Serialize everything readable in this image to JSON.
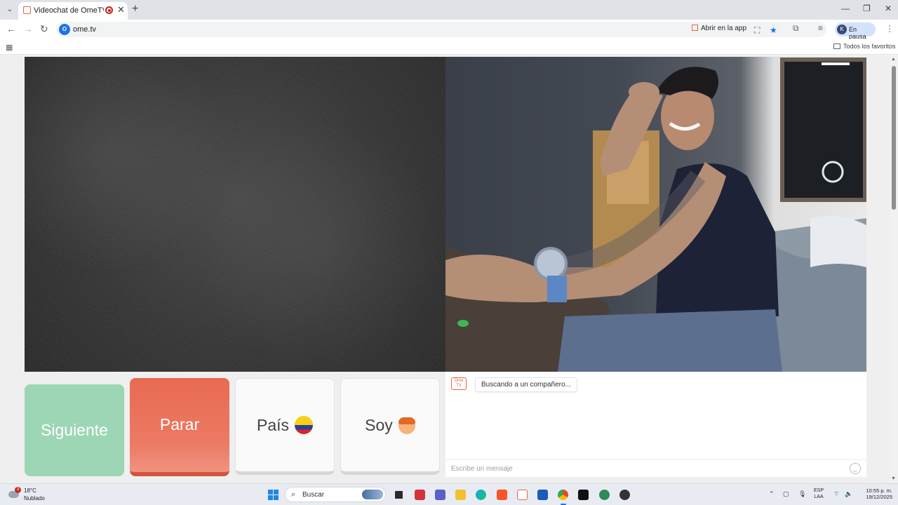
{
  "browser": {
    "tab_title": "Videochat de OmeTV: alternativa a Chatroulette",
    "new_tab": "+",
    "close_tab": "✕",
    "url": "ome.tv",
    "open_in_app": "Abrir en la app",
    "profile_initial": "K",
    "profile_status": "En pausa",
    "all_bookmarks": "Todos los favoritos"
  },
  "video": {
    "left_state": "static-noise",
    "right_state": "partner-video"
  },
  "controls": {
    "next_label": "Siguiente",
    "stop_label": "Parar",
    "country_label": "País",
    "me_label": "Soy"
  },
  "chat": {
    "logo_text": "Ome TV",
    "status_message": "Buscando a un compañero...",
    "input_placeholder": "Escribe un mensaje"
  },
  "taskbar": {
    "weather_temp": "18°C",
    "weather_desc": "Nublado",
    "weather_badge": "3",
    "search_label": "Buscar",
    "lang_line1": "ESP",
    "lang_line2": "LAA",
    "time": "10:55 p. m.",
    "date": "19/12/2025"
  },
  "colors": {
    "next_button": "#9cd6b5",
    "stop_button": "#e96a52",
    "accent": "#1a73e8"
  }
}
